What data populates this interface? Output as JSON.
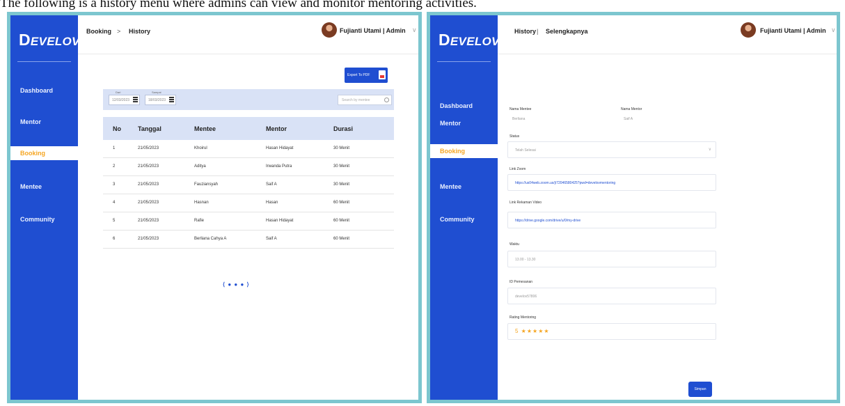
{
  "caption": "The following is a history menu where admins can view and monitor mentoring activities.",
  "colors": {
    "brand": "#1f4ed1",
    "active_nav": "#f5a623",
    "frame": "#7cc6cf",
    "table_header": "#d9e2f6"
  },
  "logo": {
    "initial": "D",
    "rest": "EVELOV"
  },
  "nav": [
    "Dashboard",
    "Mentor",
    "Booking",
    "Mentee",
    "Community"
  ],
  "active_nav": "Booking",
  "user": {
    "name": "Fujianti Utami | Admin",
    "caret": "∨"
  },
  "history_screen": {
    "breadcrumb": [
      "Booking",
      "History"
    ],
    "breadcrumb_sep": ">",
    "export_label": "Export To PDF",
    "filter": {
      "from_label": "Dari",
      "from_value": "12/03/2023",
      "to_label": "Sampai",
      "to_value": "18/03/2023",
      "search_placeholder": "Search by mentee"
    },
    "columns": [
      "No",
      "Tanggal",
      "Mentee",
      "Mentor",
      "Durasi"
    ],
    "rows": [
      [
        "1",
        "21/05/2023",
        "Khoirul",
        "Hasan Hidayat",
        "30 Menit"
      ],
      [
        "2",
        "21/05/2023",
        "Aditya",
        "Irwanda Putra",
        "30 Menit"
      ],
      [
        "3",
        "21/05/2023",
        "Fauziansyah",
        "Saif A",
        "30 Menit"
      ],
      [
        "4",
        "21/05/2023",
        "Hasnan",
        "Hasan",
        "60 Menit"
      ],
      [
        "5",
        "21/05/2023",
        "Rafie",
        "Hasan Hidayat",
        "60 Menit"
      ],
      [
        "6",
        "21/05/2023",
        "Berliana Cahya A",
        "Saif A",
        "60 Menit"
      ]
    ],
    "pager": "⟨ ● ● ● ⟩"
  },
  "detail_screen": {
    "breadcrumb": [
      "History",
      "Selengkapnya"
    ],
    "breadcrumb_sep": "|",
    "mentee_label": "Nama Mentee",
    "mentee_value": "Berliana",
    "mentor_label": "Nama Mentor",
    "mentor_value": "Saif A",
    "status_label": "Status",
    "status_value": "Telah Selesai",
    "link_zoom_label": "Link Zoom",
    "link_zoom_value": "https://us04web.zoom.us/j/72046580425?pwd=develovmentoring",
    "link_rekaman_label": "Link Rekaman Video",
    "link_rekaman_value": "https://drive.google.com/drive/u/0/my-drive",
    "waktu_label": "Waktu",
    "waktu_value": "13.00 - 13.30",
    "id_pemesanan_label": "ID Pemesanan",
    "id_pemesanan_value": "develov57806",
    "rating_label": "Rating Mentoring",
    "rating_value": "5 ★★★★★",
    "save_label": "Simpan"
  }
}
